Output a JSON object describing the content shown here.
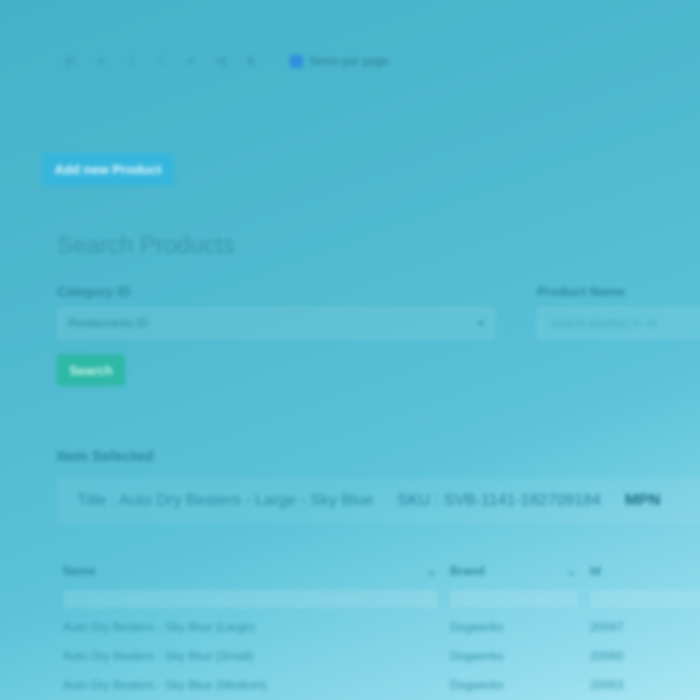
{
  "pager": {
    "first": "|<",
    "prev": "<",
    "pages": [
      "1",
      "2"
    ],
    "next": ">",
    "last": ">|",
    "page_size": "5",
    "checkbox_label": "Items per page"
  },
  "add_button": "Add new Product",
  "search": {
    "title": "Search Products",
    "category_label": "Category ID",
    "category_value": "Restaurants ID",
    "product_label": "Product Name",
    "product_placeholder": "search product n- et",
    "search_button": "Search"
  },
  "selected": {
    "title": "Item Selected",
    "item_title": "Title : Auto Dry Beaters - Large - Sky Blue",
    "item_sku": "SKU : SVB-1141-182709184",
    "item_mfr": "MPN"
  },
  "table": {
    "columns": [
      "Name",
      "Brand",
      "Id"
    ],
    "rows": [
      {
        "name": "Auto Dry Beaters - Sky Blue (Large)",
        "brand": "Dogwerks",
        "id": "20047"
      },
      {
        "name": "Auto Dry Beaters - Sky Blue (Small)",
        "brand": "Dogwerks",
        "id": "20060"
      },
      {
        "name": "Auto Dry Beaters - Sky Blue (Medium)",
        "brand": "Dogwerks",
        "id": "20053"
      }
    ]
  },
  "colors": {
    "background": "#4fbad0",
    "add_button": "#36b6dd",
    "search_button": "#2eb8a6",
    "checkbox": "#2f8fe0"
  }
}
